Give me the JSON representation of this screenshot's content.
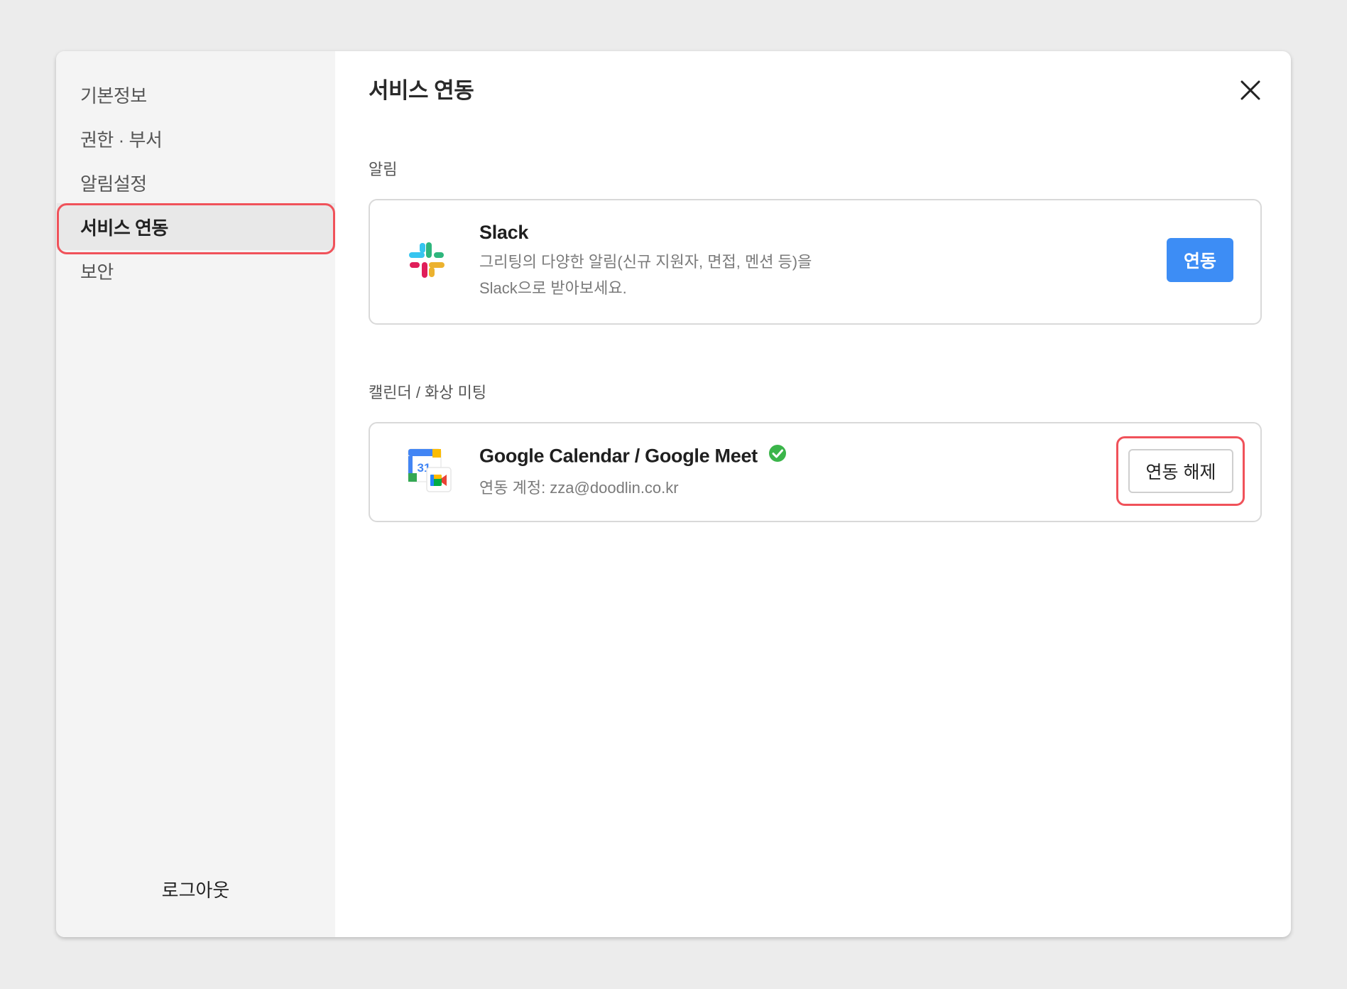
{
  "sidebar": {
    "items": [
      {
        "label": "기본정보"
      },
      {
        "label": "권한 · 부서"
      },
      {
        "label": "알림설정"
      },
      {
        "label": "서비스 연동"
      },
      {
        "label": "보안"
      }
    ],
    "active_index": 3,
    "logout_label": "로그아웃"
  },
  "main": {
    "title": "서비스 연동",
    "close_icon": "close-icon",
    "sections": [
      {
        "label": "알림",
        "card": {
          "icon": "slack-logo",
          "title": "Slack",
          "description_lines": [
            "그리팅의 다양한 알림(신규 지원자, 면접, 멘션 등)을",
            "Slack으로 받아보세요."
          ],
          "button_label": "연동"
        }
      },
      {
        "label": "캘린더 / 화상 미팅",
        "card": {
          "icon": "google-calendar-meet-logo",
          "title": "Google Calendar / Google Meet",
          "verified_icon": "check-circle-icon",
          "account_text": "연동 계정: zza@doodlin.co.kr",
          "button_label": "연동 해제"
        }
      }
    ]
  },
  "colors": {
    "accent": "#3d8df5",
    "highlight": "#f0525a",
    "verified": "#3bb54a",
    "backdrop": "#ececec",
    "sidebar_bg": "#f4f4f4"
  }
}
